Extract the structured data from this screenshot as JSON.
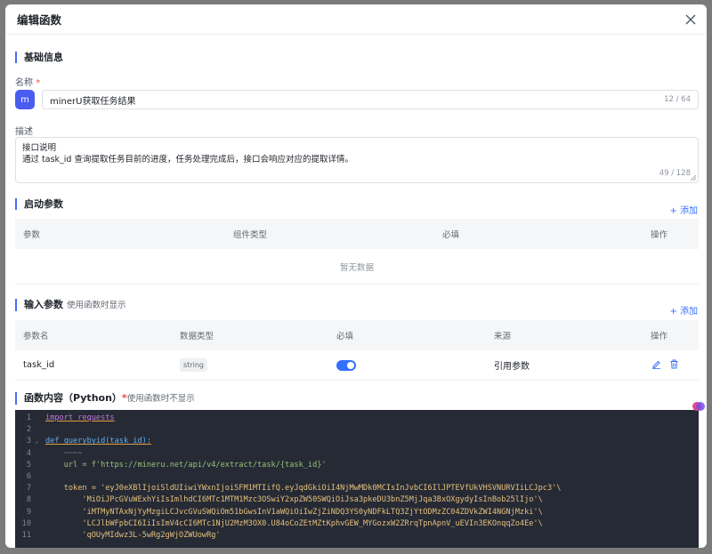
{
  "dialog": {
    "title": "编辑函数"
  },
  "basic": {
    "section_title": "基础信息",
    "name_label": "名称",
    "required_mark": "*",
    "avatar_letter": "m",
    "name_value": "minerU获取任务结果",
    "name_count": "12 / 64",
    "desc_label": "描述",
    "desc_line1": "接口说明",
    "desc_line2": "通过 task_id 查询提取任务目前的进度，任务处理完成后，接口会响应对应的提取详情。",
    "desc_count": "49 / 128"
  },
  "startup": {
    "section_title": "启动参数",
    "add_label": "+ 添加",
    "columns": [
      "参数",
      "组件类型",
      "必填",
      "操作"
    ],
    "empty_text": "暂无数据"
  },
  "input": {
    "section_title": "输入参数",
    "section_sub": "使用函数时显示",
    "add_label": "+ 添加",
    "columns": [
      "参数名",
      "数据类型",
      "必填",
      "来源",
      "操作"
    ],
    "rows": [
      {
        "name": "task_id",
        "type": "string",
        "required": true,
        "source": "引用参数"
      }
    ]
  },
  "code_section": {
    "title": "函数内容（Python）",
    "required_mark": "*",
    "sub": "使用函数时不显示",
    "lines": [
      {
        "n": "1",
        "text": "import requests"
      },
      {
        "n": "2",
        "text": ""
      },
      {
        "n": "3",
        "text": "def querybyid(task_id):"
      },
      {
        "n": "4",
        "text": "    ~~~~"
      },
      {
        "n": "5",
        "text": "    url = f'https://mineru.net/api/v4/extract/task/{task_id}'"
      },
      {
        "n": "6",
        "text": ""
      },
      {
        "n": "7",
        "text": "    token = 'eyJ0eXBlIjoiSldUIiwiYWxnIjoiSFM1MTIifQ.eyJqdGkiOiI4NjMwMDk0MCIsInJvbCI6IlJPTEVfUkVHSVNURVIiLCJpc3'\\"
      },
      {
        "n": "8",
        "text": "        'MiOiJPcGVuWExhYiIsImlhdCI6MTc1MTM1Mzc3OSwiY2xpZW50SWQiOiJsa3pkeDU3bnZ5MjJqa3BxOXgydyIsInBob25lIjo'\\"
      },
      {
        "n": "9",
        "text": "        'iMTMyNTAxNjYyMzgiLCJvcGVuSWQiOm51bGwsInV1aWQiOiIwZjZiNDQ3YS0yNDFkLTQ3ZjYtODMzZC04ZDVkZWI4NGNjMzki'\\"
      },
      {
        "n": "10",
        "text": "        'LCJlbWFpbCI6IiIsImV4cCI6MTc1NjU2MzM3OX0.U84oCoZEtMZtKphvGEW_MYGozxW2ZRrqTpnApnV_uEVIn3EKOnqqZo4Ee'\\"
      },
      {
        "n": "11",
        "text": "        'qOUyMIdwz3L-5wRg2gWjOZWUowRg'"
      }
    ]
  }
}
